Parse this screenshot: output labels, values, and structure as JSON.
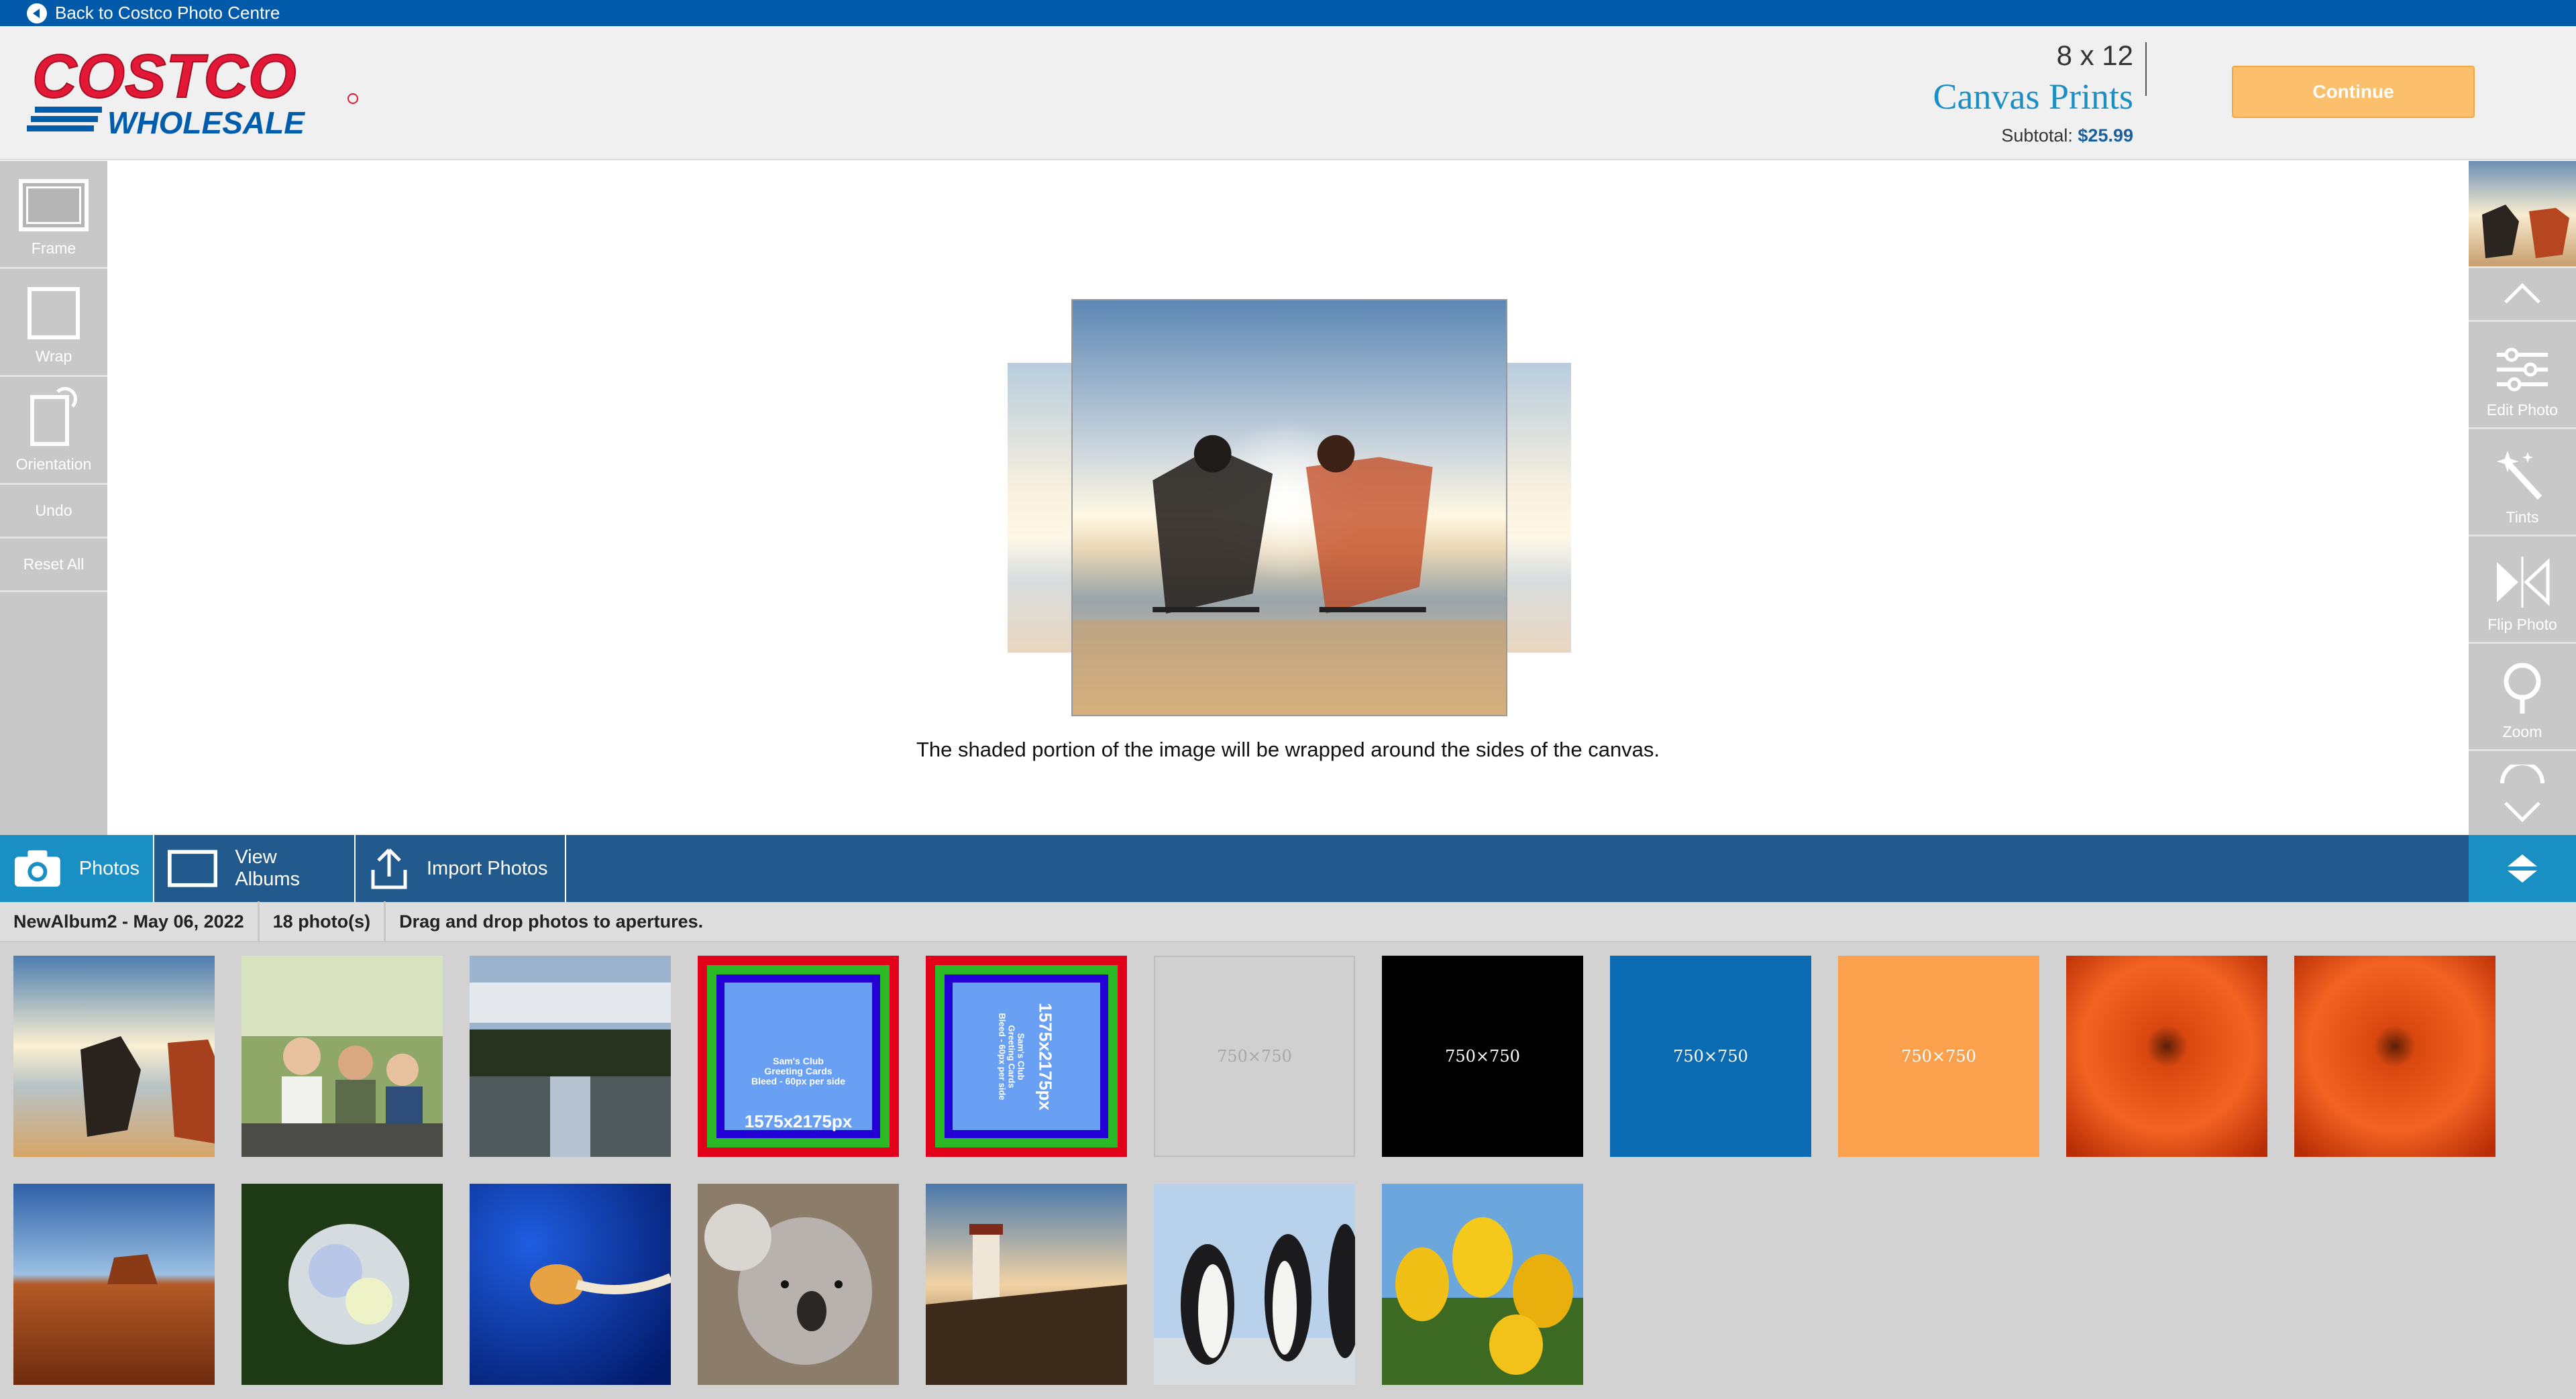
{
  "topbar": {
    "back_label": "Back to Costco Photo Centre"
  },
  "header": {
    "logo_top": "COSTCO",
    "logo_bottom": "WHOLESALE",
    "product_size": "8 x 12",
    "product_name": "Canvas Prints",
    "subtotal_label": "Subtotal:",
    "subtotal_value": "$25.99",
    "continue_label": "Continue"
  },
  "left_tools": {
    "frame": "Frame",
    "wrap": "Wrap",
    "orientation": "Orientation",
    "undo": "Undo",
    "reset_all": "Reset All"
  },
  "canvas": {
    "wrap_note": "The shaded portion of the image will be wrapped around the sides of the canvas."
  },
  "right_tools": {
    "edit_photo": "Edit Photo",
    "tints": "Tints",
    "flip_photo": "Flip Photo",
    "zoom": "Zoom"
  },
  "tabs": {
    "photos": "Photos",
    "view_albums": "View Albums",
    "import_photos": "Import Photos"
  },
  "info": {
    "album": "NewAlbum2 - May 06, 2022",
    "count": "18  photo(s)",
    "hint": "Drag and drop photos to apertures."
  },
  "placeholders": {
    "p750": "750×750",
    "sams_title": "Sam's Club\nGreeting Cards\nBleed - 60px per side",
    "sams_size": "1575x2175px"
  },
  "colors": {
    "topbar": "#005aa9",
    "accent": "#1a8fc4",
    "continue": "#fcbf6b",
    "costco_red": "#e31837",
    "costco_blue": "#005dab"
  }
}
